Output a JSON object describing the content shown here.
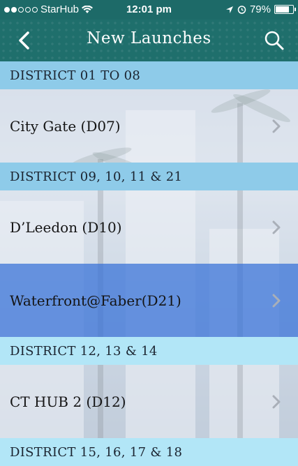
{
  "status_bar": {
    "carrier": "StarHub",
    "time": "12:01 pm",
    "battery": "79%",
    "battery_level": 0.79
  },
  "nav": {
    "title": "New Launches",
    "back_icon": "chevron-left-icon",
    "search_icon": "search-icon"
  },
  "sections": [
    {
      "header": "DISTRICT 01 TO 08",
      "color": "#8ecbe9",
      "items": [
        {
          "label": "City Gate (D07)"
        }
      ]
    },
    {
      "header": "DISTRICT 09, 10, 11 & 21",
      "color": "#8ecbe9",
      "items": [
        {
          "label": "D’Leedon (D10)"
        },
        {
          "label": "Waterfront@Faber(D21)",
          "selected": true
        }
      ]
    },
    {
      "header": "DISTRICT 12, 13 & 14",
      "color": "#b2e6f7",
      "items": [
        {
          "label": "CT HUB 2 (D12)"
        }
      ]
    },
    {
      "header": "DISTRICT 15, 16, 17 & 18",
      "color": "#b2e6f7",
      "items": []
    }
  ]
}
